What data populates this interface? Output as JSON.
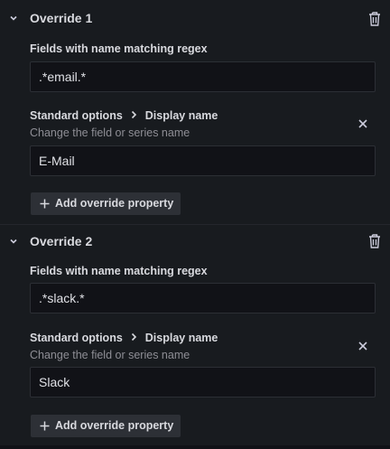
{
  "overrides": [
    {
      "title": "Override 1",
      "matcher_label": "Fields with name matching regex",
      "matcher_value": ".*email.*",
      "property_category": "Standard options",
      "property_name": "Display name",
      "property_description": "Change the field or series name",
      "property_value": "E-Mail",
      "add_button_label": "Add override property"
    },
    {
      "title": "Override 2",
      "matcher_label": "Fields with name matching regex",
      "matcher_value": ".*slack.*",
      "property_category": "Standard options",
      "property_name": "Display name",
      "property_description": "Change the field or series name",
      "property_value": "Slack",
      "add_button_label": "Add override property"
    }
  ],
  "icons": {
    "collapse": "chevron-down-icon",
    "delete": "trash-icon",
    "breadcrumb": "chevron-right-icon",
    "remove": "close-icon",
    "add": "plus-icon"
  },
  "colors": {
    "background": "#111217",
    "panel": "#181b1f",
    "input_background": "#111217",
    "button_background": "#2d3036",
    "text_primary": "#d8d9de",
    "text_secondary": "#8e8e95"
  }
}
